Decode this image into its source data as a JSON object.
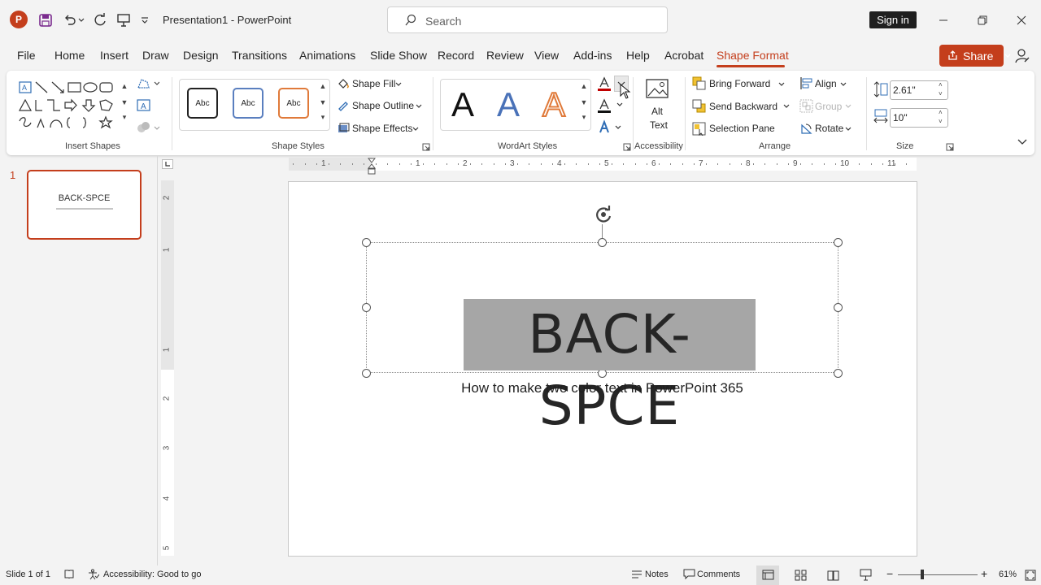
{
  "app": {
    "doc_title": "Presentation1 - PowerPoint",
    "search_placeholder": "Search",
    "sign_in": "Sign in",
    "share": "Share",
    "accent_color": "#c43e1c"
  },
  "tabs": [
    {
      "label": "File"
    },
    {
      "label": "Home"
    },
    {
      "label": "Insert"
    },
    {
      "label": "Draw"
    },
    {
      "label": "Design"
    },
    {
      "label": "Transitions"
    },
    {
      "label": "Animations"
    },
    {
      "label": "Slide Show"
    },
    {
      "label": "Record"
    },
    {
      "label": "Review"
    },
    {
      "label": "View"
    },
    {
      "label": "Add-ins"
    },
    {
      "label": "Help"
    },
    {
      "label": "Acrobat"
    },
    {
      "label": "Shape Format"
    }
  ],
  "ribbon": {
    "groups": {
      "insert_shapes": "Insert Shapes",
      "shape_styles": "Shape Styles",
      "wordart_styles": "WordArt Styles",
      "accessibility": "Accessibility",
      "arrange": "Arrange",
      "size": "Size"
    },
    "shape_style_samples": [
      "Abc",
      "Abc",
      "Abc"
    ],
    "shape_fill": "Shape Fill",
    "shape_outline": "Shape Outline",
    "shape_effects": "Shape Effects",
    "wordart_samples": [
      "A",
      "A",
      "A"
    ],
    "alt_text_line1": "Alt",
    "alt_text_line2": "Text",
    "bring_forward": "Bring Forward",
    "send_backward": "Send Backward",
    "selection_pane": "Selection Pane",
    "align": "Align",
    "group": "Group",
    "rotate": "Rotate",
    "height_value": "2.61\"",
    "width_value": "10\""
  },
  "thumbnails": [
    {
      "number": "1",
      "title": "BACK-SPCE"
    }
  ],
  "slide": {
    "title": "BACK-SPCE",
    "subtitle": "How to make two color text in PowerPoint 365"
  },
  "rulers": {
    "horizontal": [
      "1",
      "1",
      "2",
      "3",
      "4",
      "5",
      "6",
      "7",
      "8",
      "9",
      "10",
      "11"
    ],
    "vertical": [
      "2",
      "1",
      "1",
      "2",
      "3",
      "4",
      "5"
    ]
  },
  "statusbar": {
    "slide_info": "Slide 1 of 1",
    "accessibility": "Accessibility: Good to go",
    "notes": "Notes",
    "comments": "Comments",
    "zoom": "61%"
  }
}
